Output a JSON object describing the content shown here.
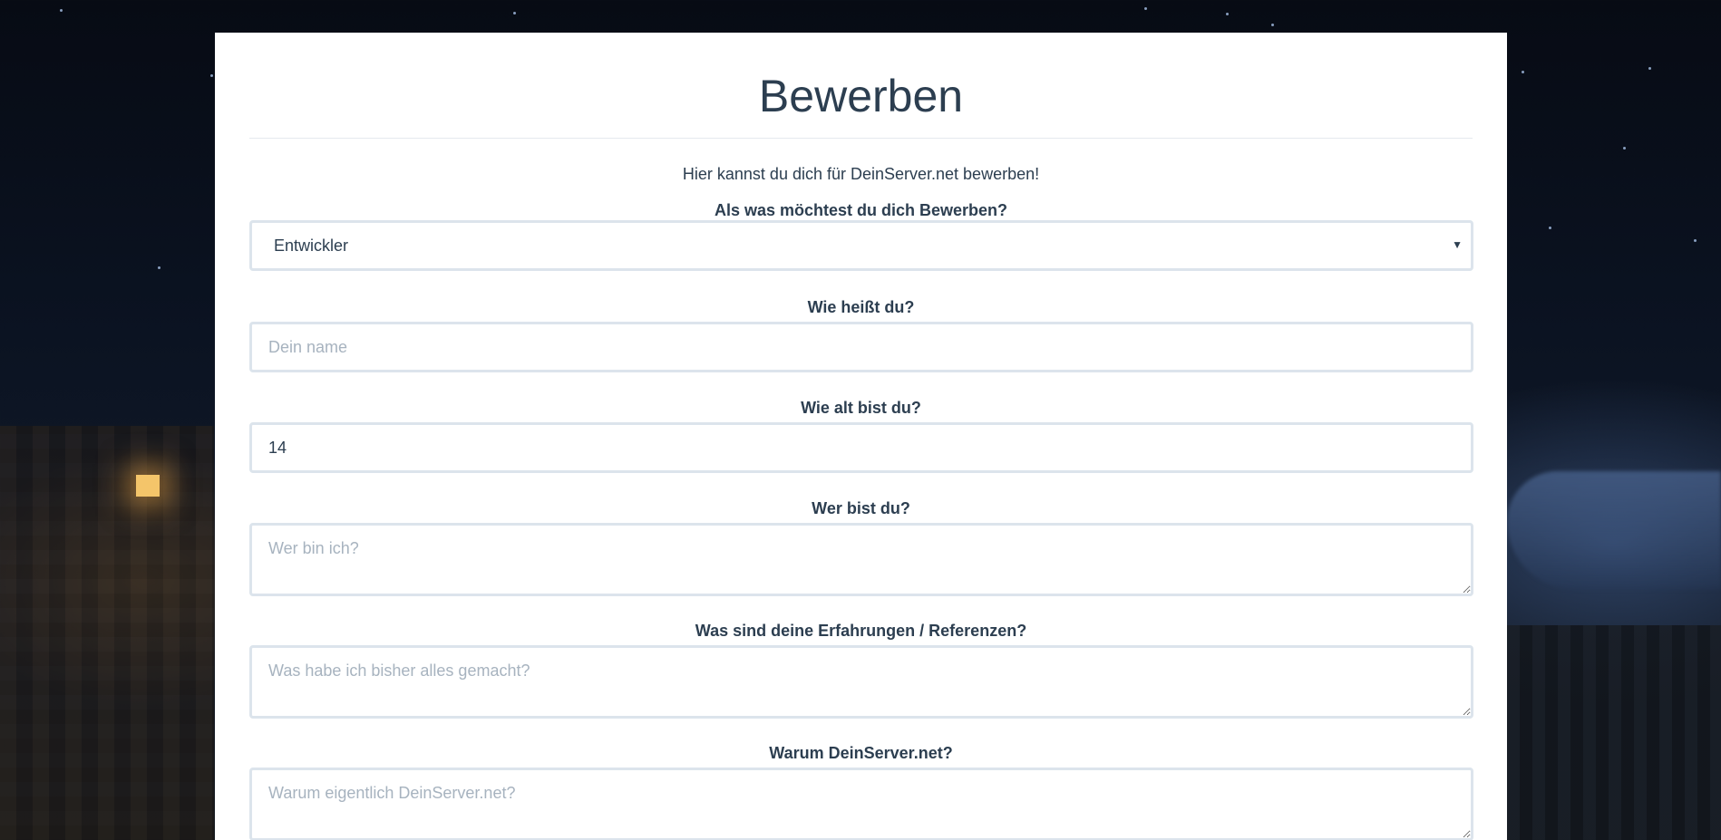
{
  "page": {
    "title": "Bewerben",
    "intro": "Hier kannst du dich für DeinServer.net bewerben!"
  },
  "form": {
    "role": {
      "label": "Als was möchtest du dich Bewerben?",
      "selected": "Entwickler"
    },
    "name": {
      "label": "Wie heißt du?",
      "placeholder": "Dein name",
      "value": ""
    },
    "age": {
      "label": "Wie alt bist du?",
      "value": "14"
    },
    "about": {
      "label": "Wer bist du?",
      "placeholder": "Wer bin ich?"
    },
    "experience": {
      "label": "Was sind deine Erfahrungen / Referenzen?",
      "placeholder": "Was habe ich bisher alles gemacht?"
    },
    "why": {
      "label": "Warum DeinServer.net?",
      "placeholder": "Warum eigentlich DeinServer.net?"
    }
  },
  "icons": {
    "select_arrow": "caret-down-icon"
  }
}
